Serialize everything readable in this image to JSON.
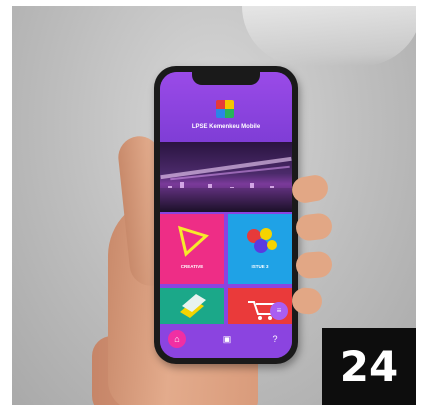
{
  "app": {
    "title": "LPSE Kemenkeu Mobile"
  },
  "tiles": [
    {
      "label": "CREATIVE",
      "color": "#ee2d86",
      "icon": "triangle-icon"
    },
    {
      "label": "ISTUE 3",
      "color": "#1fa2e6",
      "icon": "hexagons-icon"
    },
    {
      "label": "",
      "color": "#1ba889",
      "icon": "layers-icon"
    },
    {
      "label": "",
      "color": "#ea3a3a",
      "icon": "cart-icon"
    }
  ],
  "bottom_nav": [
    {
      "name": "home",
      "icon": "home-icon",
      "active": true
    },
    {
      "name": "gallery",
      "icon": "gallery-icon",
      "active": false
    },
    {
      "name": "help",
      "icon": "help-icon",
      "active": false
    }
  ],
  "fab": {
    "icon": "menu-icon"
  },
  "badge": {
    "number": "24"
  },
  "colors": {
    "primary": "#8b44e0",
    "accent": "#f02fa3"
  }
}
